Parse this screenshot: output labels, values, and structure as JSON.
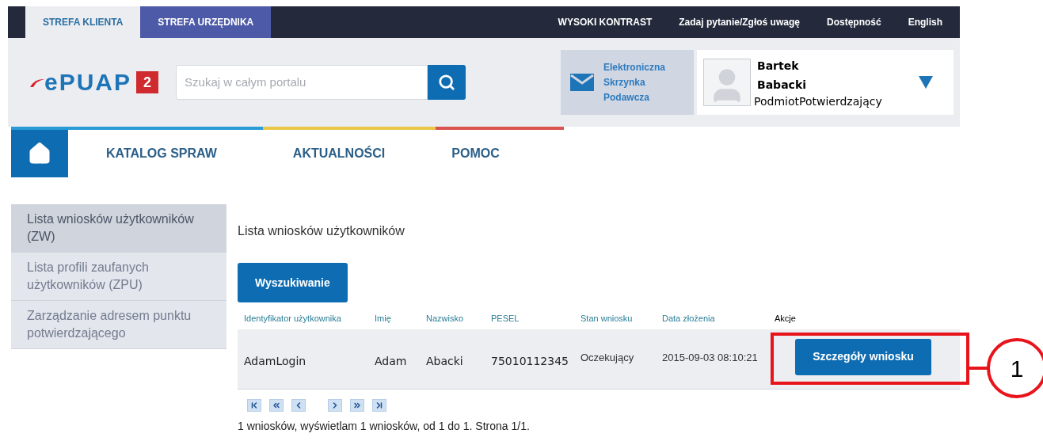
{
  "top_bar": {
    "zones": [
      {
        "label": "STREFA KLIENTA",
        "selected": true
      },
      {
        "label": "STREFA URZĘDNIKA",
        "selected": false
      }
    ],
    "links": [
      "WYSOKI KONTRAST",
      "Zadaj pytanie/Zgłoś uwagę",
      "Dostępność",
      "English"
    ]
  },
  "header": {
    "logo": {
      "text": "ePUAP",
      "badge": "2"
    },
    "search": {
      "placeholder": "Szukaj w całym portalu"
    },
    "mailbox": [
      "Elektroniczna",
      "Skrzynka",
      "Podawcza"
    ],
    "user": {
      "first_name": "Bartek",
      "last_name": "Babacki",
      "role": "PodmiotPotwierdzający"
    }
  },
  "nav": [
    "KATALOG SPRAW",
    "AKTUALNOŚCI",
    "POMOC"
  ],
  "sidebar": [
    {
      "label": "Lista wniosków użytkowników (ZW)",
      "selected": true
    },
    {
      "label": "Lista profili zaufanych użytkowników (ZPU)",
      "selected": false
    },
    {
      "label": "Zarządzanie adresem punktu potwierdzającego",
      "selected": false
    }
  ],
  "main": {
    "title": "Lista wniosków użytkowników",
    "search_button": "Wyszukiwanie",
    "table": {
      "columns": [
        "Identyfikator użytkownika",
        "Imię",
        "Nazwisko",
        "PESEL",
        "Stan wniosku",
        "Data złożenia",
        "Akcje"
      ],
      "rows": [
        {
          "cells": [
            "AdamLogin",
            "Adam",
            "Abacki",
            "75010112345",
            "Oczekujący",
            "2015-09-03 08:10:21"
          ],
          "action": "Szczegóły wniosku",
          "highlighted": true
        }
      ]
    },
    "pagination": [
      {
        "kind": "first"
      },
      {
        "kind": "prev-page"
      },
      {
        "kind": "prev"
      },
      {
        "kind": "next"
      },
      {
        "kind": "next-page"
      },
      {
        "kind": "last"
      }
    ],
    "summary": "1 wniosków, wyświetlam 1 wniosków, od 1 do 1. Strona 1/1."
  },
  "annotation": {
    "label": "1"
  }
}
